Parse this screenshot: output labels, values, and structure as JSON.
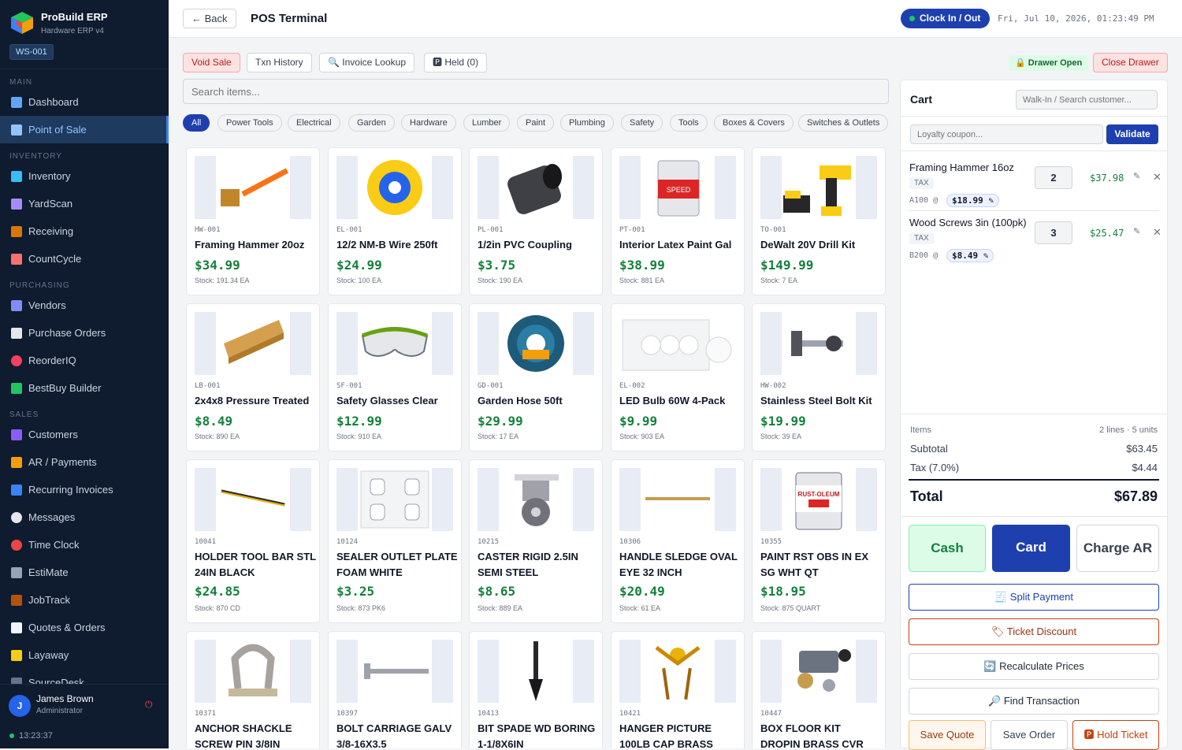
{
  "brand": {
    "name": "ProBuild ERP",
    "sub": "Hardware ERP v4",
    "workstation": "WS-001"
  },
  "nav": {
    "main_label": "MAIN",
    "dashboard": "Dashboard",
    "pos": "Point of Sale",
    "inventory_label": "INVENTORY",
    "inventory": "Inventory",
    "yardscan": "YardScan",
    "receiving": "Receiving",
    "countcycle": "CountCycle",
    "purchasing_label": "PURCHASING",
    "vendors": "Vendors",
    "purchase_orders": "Purchase Orders",
    "reorderiq": "ReorderIQ",
    "bestbuy": "BestBuy Builder",
    "sales_label": "SALES",
    "customers": "Customers",
    "ar": "AR / Payments",
    "recurring": "Recurring Invoices",
    "messages": "Messages",
    "timeclock": "Time Clock",
    "estimate": "EstiMate",
    "jobtrack": "JobTrack",
    "quotes": "Quotes & Orders",
    "layaway": "Layaway",
    "sourcedesk": "SourceDesk"
  },
  "user": {
    "initial": "J",
    "name": "James Brown",
    "role": "Administrator",
    "clock": "13:23:37"
  },
  "header": {
    "back": "← Back",
    "title": "POS Terminal",
    "clock_btn": "Clock In / Out",
    "datetime": "Fri, Jul 10, 2026, 01:23:49 PM"
  },
  "actions": {
    "void": "Void Sale",
    "history": "Txn History",
    "lookup": "🔍 Invoice Lookup",
    "held": "🅿 Held (0)",
    "drawer_open": "🔒 Drawer Open",
    "close_drawer": "Close Drawer"
  },
  "search": {
    "placeholder": "Search items..."
  },
  "categories": [
    "All",
    "Power Tools",
    "Electrical",
    "Garden",
    "Hardware",
    "Lumber",
    "Paint",
    "Plumbing",
    "Safety",
    "Tools",
    "Boxes & Covers",
    "Switches & Outlets"
  ],
  "products": [
    {
      "sku": "HW-001",
      "name": "Framing Hammer 20oz",
      "price": "$34.99",
      "stock": "Stock: 191.34 EA"
    },
    {
      "sku": "EL-001",
      "name": "12/2 NM-B Wire 250ft",
      "price": "$24.99",
      "stock": "Stock: 100 EA"
    },
    {
      "sku": "PL-001",
      "name": "1/2in PVC Coupling",
      "price": "$3.75",
      "stock": "Stock: 190 EA"
    },
    {
      "sku": "PT-001",
      "name": "Interior Latex Paint Gal",
      "price": "$38.99",
      "stock": "Stock: 881 EA"
    },
    {
      "sku": "TO-001",
      "name": "DeWalt 20V Drill Kit",
      "price": "$149.99",
      "stock": "Stock: 7 EA"
    },
    {
      "sku": "LB-001",
      "name": "2x4x8 Pressure Treated",
      "price": "$8.49",
      "stock": "Stock: 890 EA"
    },
    {
      "sku": "SF-001",
      "name": "Safety Glasses Clear",
      "price": "$12.99",
      "stock": "Stock: 910 EA"
    },
    {
      "sku": "GD-001",
      "name": "Garden Hose 50ft",
      "price": "$29.99",
      "stock": "Stock: 17 EA"
    },
    {
      "sku": "EL-002",
      "name": "LED Bulb 60W 4-Pack",
      "price": "$9.99",
      "stock": "Stock: 903 EA"
    },
    {
      "sku": "HW-002",
      "name": "Stainless Steel Bolt Kit",
      "price": "$19.99",
      "stock": "Stock: 39 EA"
    },
    {
      "sku": "10041",
      "name": "HOLDER TOOL BAR STL 24IN BLACK",
      "price": "$24.85",
      "stock": "Stock: 870 CD"
    },
    {
      "sku": "10124",
      "name": "SEALER OUTLET PLATE FOAM WHITE",
      "price": "$3.25",
      "stock": "Stock: 873 PK6"
    },
    {
      "sku": "10215",
      "name": "CASTER RIGID 2.5IN SEMI STEEL",
      "price": "$8.65",
      "stock": "Stock: 889 EA"
    },
    {
      "sku": "10306",
      "name": "HANDLE SLEDGE OVAL EYE 32 INCH",
      "price": "$20.49",
      "stock": "Stock: 61 EA"
    },
    {
      "sku": "10355",
      "name": "PAINT RST OBS IN EX SG WHT QT",
      "price": "$18.95",
      "stock": "Stock: 875 QUART"
    },
    {
      "sku": "10371",
      "name": "ANCHOR SHACKLE SCREW PIN 3/8IN",
      "price": "",
      "stock": ""
    },
    {
      "sku": "10397",
      "name": "BOLT CARRIAGE GALV 3/8-16X3.5",
      "price": "",
      "stock": ""
    },
    {
      "sku": "10413",
      "name": "BIT SPADE WD BORING 1-1/8X6IN",
      "price": "",
      "stock": ""
    },
    {
      "sku": "10421",
      "name": "HANGER PICTURE 100LB CAP BRASS",
      "price": "",
      "stock": ""
    },
    {
      "sku": "10447",
      "name": "BOX FLOOR KIT DROPIN BRASS CVR",
      "price": "",
      "stock": ""
    }
  ],
  "cart": {
    "title": "Cart",
    "customer_placeholder": "Walk-In / Search customer...",
    "coupon_placeholder": "Loyalty coupon...",
    "validate": "Validate",
    "lines": [
      {
        "name": "Framing Hammer 16oz",
        "tax": "TAX",
        "sku": "A100 @",
        "unit": "$18.99 ✎",
        "qty": "2",
        "total": "$37.98",
        "edit": "✎",
        "remove": "✕"
      },
      {
        "name": "Wood Screws 3in (100pk)",
        "tax": "TAX",
        "sku": "B200 @",
        "unit": "$8.49 ✎",
        "qty": "3",
        "total": "$25.47",
        "edit": "✎",
        "remove": "✕"
      }
    ],
    "items_label": "Items",
    "items_value": "2 lines · 5 units",
    "subtotal_label": "Subtotal",
    "subtotal": "$63.45",
    "tax_label": "Tax (7.0%)",
    "tax": "$4.44",
    "total_label": "Total",
    "total": "$67.89",
    "cash": "Cash",
    "card": "Card",
    "charge_ar": "Charge AR",
    "split": "🧾 Split Payment",
    "discount": "🏷 Ticket Discount",
    "recalc": "🔄 Recalculate Prices",
    "find": "🔎 Find Transaction",
    "save_quote": "Save Quote",
    "save_order": "Save Order",
    "hold": "🅿 Hold Ticket"
  },
  "colors": {
    "accent": "#1e40af",
    "sidebar": "#0f1b2e",
    "price": "#15803d",
    "danger": "#b91c1c"
  }
}
